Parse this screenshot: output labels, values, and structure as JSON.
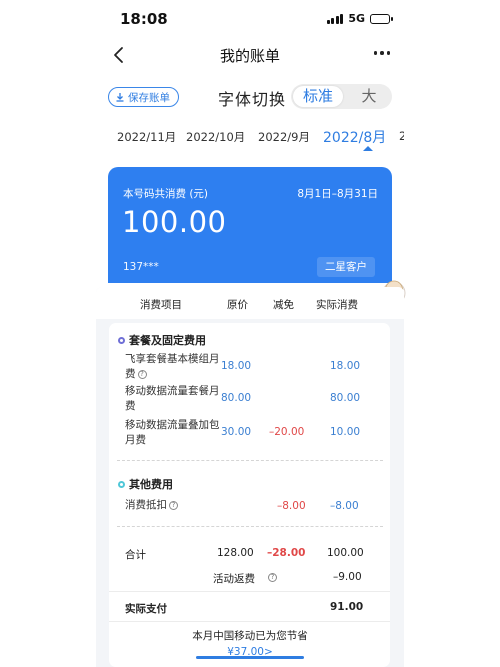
{
  "status_bar": {
    "time": "18:08",
    "network": "5G"
  },
  "nav": {
    "title": "我的账单"
  },
  "toolbar": {
    "save_label": "保存账单",
    "font_switch_label": "字体切换",
    "font_standard": "标准",
    "font_large": "大"
  },
  "month_tabs": [
    {
      "label": "2022/11月",
      "active": false
    },
    {
      "label": "2022/10月",
      "active": false
    },
    {
      "label": "2022/9月",
      "active": false
    },
    {
      "label": "2022/8月",
      "active": true
    },
    {
      "label": "2",
      "active": false
    }
  ],
  "summary": {
    "label": "本号码共消费 (元)",
    "range": "8月1日–8月31日",
    "amount": "100.00",
    "phone": "137***",
    "level": "二星客户"
  },
  "table": {
    "headers": [
      "消费项目",
      "原价",
      "减免",
      "实际消费"
    ],
    "sections": [
      {
        "title": "套餐及固定费用",
        "items": [
          {
            "name": "飞享套餐基本模组月费",
            "original": "18.00",
            "discount": "",
            "actual": "18.00"
          },
          {
            "name": "移动数据流量套餐月费",
            "original": "80.00",
            "discount": "",
            "actual": "80.00"
          },
          {
            "name": "移动数据流量叠加包月费",
            "original": "30.00",
            "discount": "–20.00",
            "actual": "10.00"
          }
        ]
      },
      {
        "title": "其他费用",
        "items": [
          {
            "name": "消费抵扣",
            "original": "",
            "discount": "–8.00",
            "actual": "–8.00"
          }
        ]
      }
    ],
    "total": {
      "label": "合计",
      "original": "128.00",
      "discount": "–28.00",
      "actual": "100.00"
    },
    "rebate": {
      "label": "活动返费",
      "actual": "–9.00"
    },
    "paid": {
      "label": "实际支付",
      "actual": "91.00"
    },
    "saving_text": "本月中国移动已为您节省",
    "saving_amount": "¥37.00>"
  },
  "colors": {
    "accent": "#2e7ff0",
    "negative": "#e04848",
    "value": "#3b7fd1"
  }
}
